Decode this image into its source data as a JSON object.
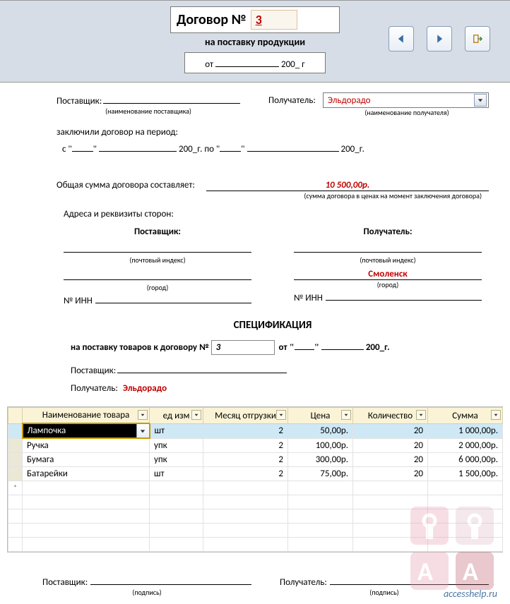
{
  "header": {
    "title_label": "Договор №",
    "contract_number": "3",
    "subtitle": "на поставку продукции",
    "date_label_prefix": "от",
    "date_year_suffix": "200_ г"
  },
  "nav": {
    "prev": "prev",
    "next": "next",
    "exit": "exit"
  },
  "supplier_section": {
    "label": "Поставщик:",
    "value": "",
    "caption": "(наименование поставщика)"
  },
  "recipient_section": {
    "label": "Получатель:",
    "value": "Эльдорадо",
    "caption": "(наименование получателя)"
  },
  "period": {
    "intro": "заключили договор на период:",
    "line": "с",
    "po": "по",
    "year_suffix": "200_г."
  },
  "total": {
    "label": "Общая сумма договора составляет:",
    "amount": "10 500,00р.",
    "caption": "(сумма договора в ценах на момент заключения договора)"
  },
  "addresses": {
    "title": "Адреса и реквизиты сторон:",
    "supplier_hdr": "Поставщик:",
    "recipient_hdr": "Получатель:",
    "post_caption": "(почтовый индекс)",
    "city_caption": "(город)",
    "inn_label": "№ ИНН",
    "supplier": {
      "post": "",
      "city": "",
      "inn": ""
    },
    "recipient": {
      "post": "",
      "city": "Смоленск",
      "inn": ""
    }
  },
  "spec": {
    "title": "СПЕЦИФИКАЦИЯ",
    "for_text": "на поставку товаров к договору №",
    "number": "3",
    "ot": "от",
    "year_suffix": "200_г.",
    "supplier_label": "Поставщик:",
    "supplier_value": "",
    "recipient_label": "Получатель:",
    "recipient_value": "Эльдорадо"
  },
  "table": {
    "columns": [
      "Наименование товара",
      "ед изм",
      "Месяц отгрузки",
      "Цена",
      "Количество",
      "Сумма"
    ],
    "rows": [
      {
        "name": "Лампочка",
        "unit": "шт",
        "month": "2",
        "price": "50,00р.",
        "qty": "20",
        "sum": "1 000,00р.",
        "selected": true,
        "active_cell": true
      },
      {
        "name": "Ручка",
        "unit": "упк",
        "month": "2",
        "price": "100,00р.",
        "qty": "20",
        "sum": "2 000,00р."
      },
      {
        "name": "Бумага",
        "unit": "упк",
        "month": "2",
        "price": "300,00р.",
        "qty": "20",
        "sum": "6 000,00р."
      },
      {
        "name": "Батарейки",
        "unit": "шт",
        "month": "2",
        "price": "75,00р.",
        "qty": "20",
        "sum": "1 500,00р."
      }
    ],
    "new_row_marker": "*"
  },
  "footer": {
    "supplier_label": "Поставщик:",
    "recipient_label": "Получатель:",
    "caption": "(подпись)"
  },
  "brand": "accesshelp.ru"
}
